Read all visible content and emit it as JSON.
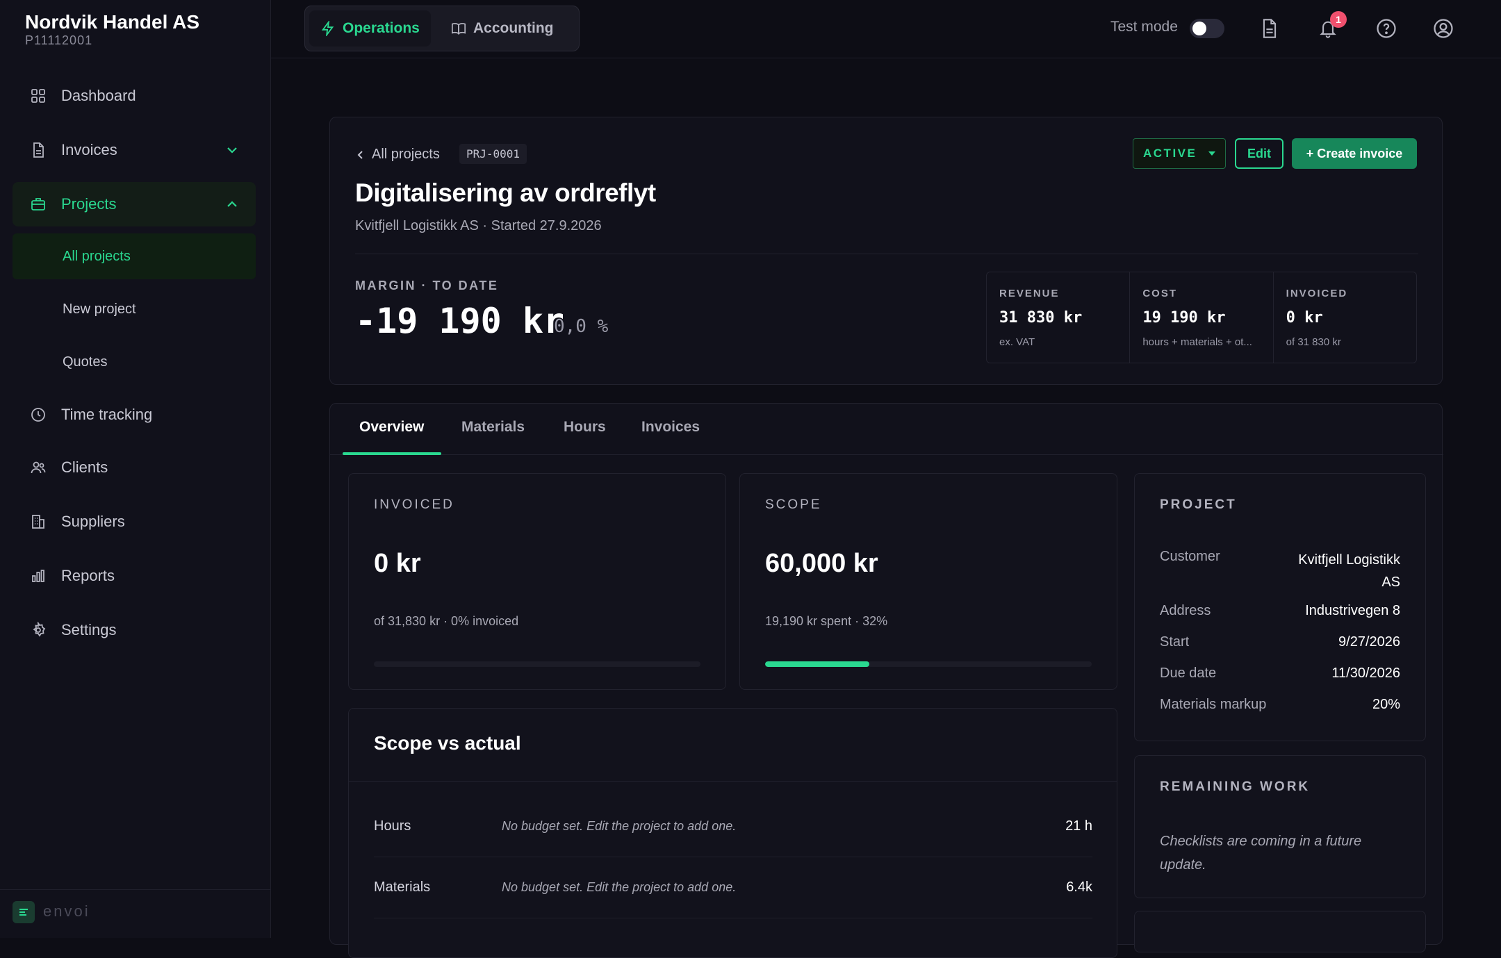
{
  "company": {
    "name": "Nordvik Handel AS",
    "id": "P11112001"
  },
  "sidebar": {
    "items": [
      {
        "label": "Dashboard"
      },
      {
        "label": "Invoices"
      },
      {
        "label": "Projects"
      },
      {
        "label": "Time tracking"
      },
      {
        "label": "Clients"
      },
      {
        "label": "Suppliers"
      },
      {
        "label": "Reports"
      },
      {
        "label": "Settings"
      }
    ],
    "project_subitems": [
      {
        "label": "All projects"
      },
      {
        "label": "New project"
      },
      {
        "label": "Quotes"
      }
    ],
    "footer_logo": "envoi"
  },
  "topbar": {
    "modes": [
      {
        "label": "Operations"
      },
      {
        "label": "Accounting"
      }
    ],
    "test_mode_label": "Test mode",
    "test_mode_on": false,
    "notification_count": "1"
  },
  "project": {
    "back_label": "All projects",
    "code": "PRJ-0001",
    "title": "Digitalisering av ordreflyt",
    "subtitle": "Kvitfjell Logistikk AS · Started 27.9.2026",
    "status": "ACTIVE",
    "edit_label": "Edit",
    "create_invoice_label": "+ Create invoice",
    "margin_label": "MARGIN · TO DATE",
    "margin_value": "-19 190 kr",
    "margin_pct": "0,0 %",
    "stats": [
      {
        "label": "REVENUE",
        "value": "31 830 kr",
        "sub": "ex. VAT"
      },
      {
        "label": "COST",
        "value": "19 190 kr",
        "sub": "hours + materials + ot..."
      },
      {
        "label": "INVOICED",
        "value": "0 kr",
        "sub": "of 31 830 kr"
      }
    ]
  },
  "tabs": [
    {
      "label": "Overview"
    },
    {
      "label": "Materials"
    },
    {
      "label": "Hours"
    },
    {
      "label": "Invoices"
    }
  ],
  "overview": {
    "invoiced": {
      "label": "INVOICED",
      "value": "0 kr",
      "sub": "of 31,830 kr · 0% invoiced",
      "progress": 0
    },
    "scope": {
      "label": "SCOPE",
      "value": "60,000 kr",
      "sub": "19,190 kr spent · 32%",
      "progress": 0.32
    },
    "scope_vs_actual": {
      "title": "Scope vs actual",
      "rows": [
        {
          "label": "Hours",
          "note": "No budget set. Edit the project to add one.",
          "value": "21 h"
        },
        {
          "label": "Materials",
          "note": "No budget set. Edit the project to add one.",
          "value": "6.4k"
        }
      ]
    },
    "project_panel": {
      "label": "PROJECT",
      "fields": [
        {
          "k": "Customer",
          "v": "Kvitfjell Logistikk AS"
        },
        {
          "k": "Address",
          "v": "Industrivegen 8"
        },
        {
          "k": "Start",
          "v": "9/27/2026"
        },
        {
          "k": "Due date",
          "v": "11/30/2026"
        },
        {
          "k": "Materials markup",
          "v": "20%"
        }
      ]
    },
    "remaining_work": {
      "label": "REMAINING WORK",
      "note": "Checklists are coming in a future update."
    }
  },
  "colors": {
    "accent": "#2ad890",
    "background": "#0d0d15",
    "panel": "#11111b",
    "badge": "#f0506e",
    "primary_button": "#17875a"
  }
}
